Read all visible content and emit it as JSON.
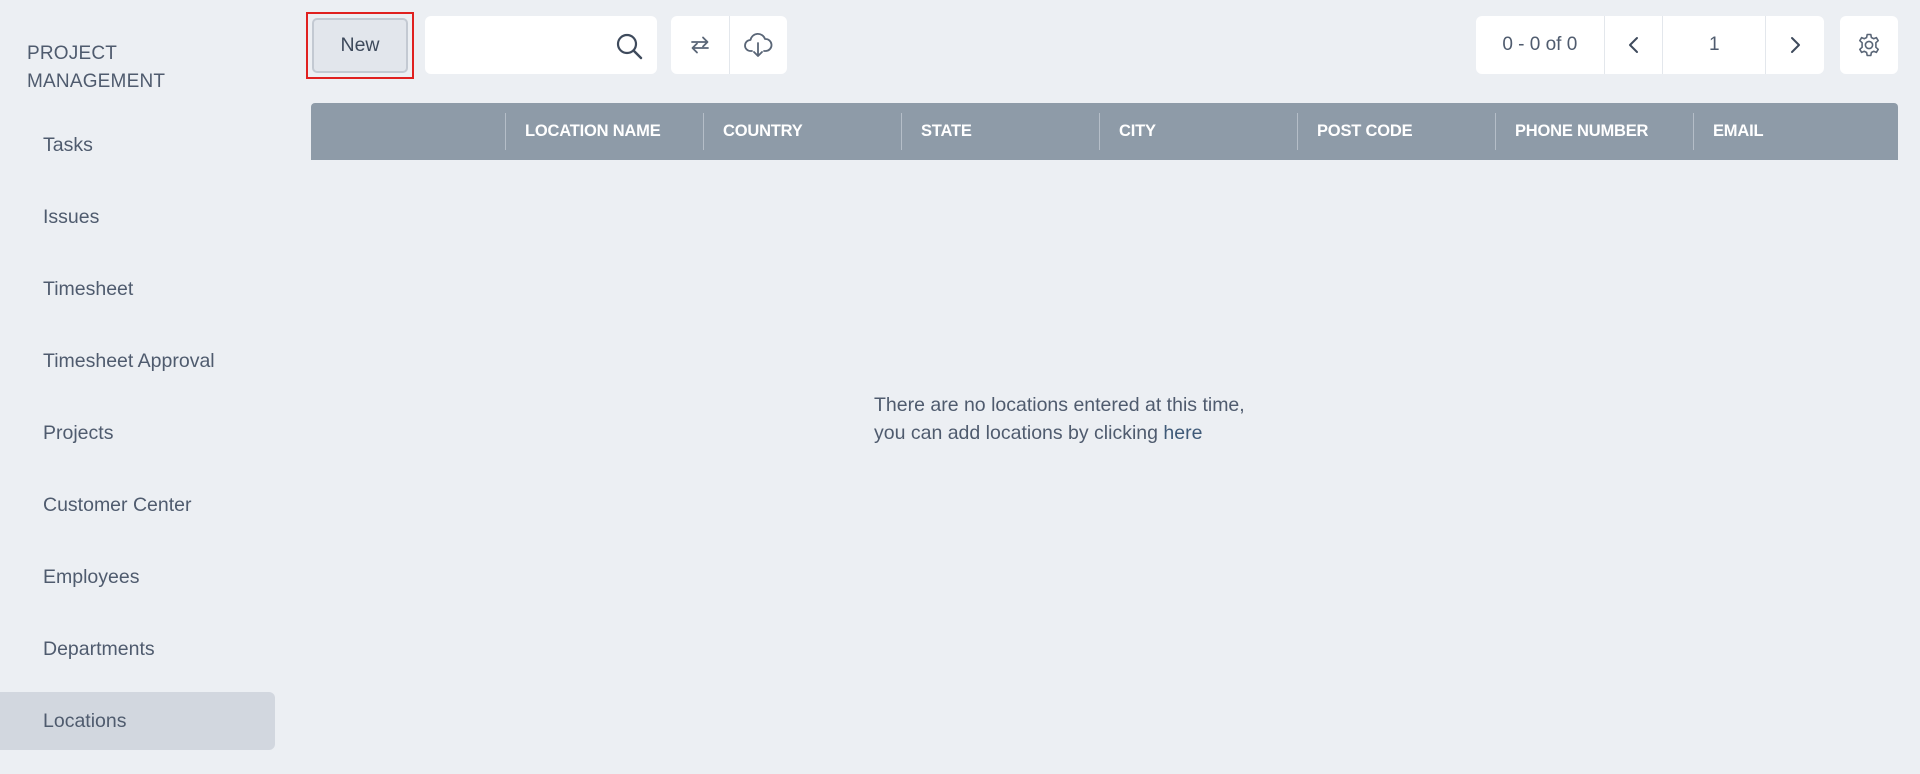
{
  "sidebar": {
    "title": "PROJECT MANAGEMENT",
    "items": [
      {
        "label": "Tasks",
        "active": false
      },
      {
        "label": "Issues",
        "active": false
      },
      {
        "label": "Timesheet",
        "active": false
      },
      {
        "label": "Timesheet Approval",
        "active": false
      },
      {
        "label": "Projects",
        "active": false
      },
      {
        "label": "Customer Center",
        "active": false
      },
      {
        "label": "Employees",
        "active": false
      },
      {
        "label": "Departments",
        "active": false
      },
      {
        "label": "Locations",
        "active": true
      }
    ]
  },
  "toolbar": {
    "new_label": "New",
    "search": {
      "value": "",
      "placeholder": "",
      "icon": "search-icon"
    },
    "icons": [
      "refresh-icon",
      "cloud-download-icon"
    ],
    "pagination": {
      "range_text": "0 - 0 of 0",
      "page": "1",
      "prev_icon": "chevron-left-icon",
      "next_icon": "chevron-right-icon"
    },
    "settings_icon": "gear-icon"
  },
  "table": {
    "columns": [
      "LOCATION NAME",
      "COUNTRY",
      "STATE",
      "CITY",
      "POST CODE",
      "PHONE NUMBER",
      "EMAIL"
    ],
    "rows": []
  },
  "empty_state": {
    "line1": "There are no locations entered at this time,",
    "line2_prefix": "you can add locations by clicking",
    "link_label": "here"
  },
  "colors": {
    "background": "#eceff3",
    "header_bg": "#8e9ba8",
    "active_item_bg": "#d2d7df",
    "highlight_border": "#e0201f"
  }
}
